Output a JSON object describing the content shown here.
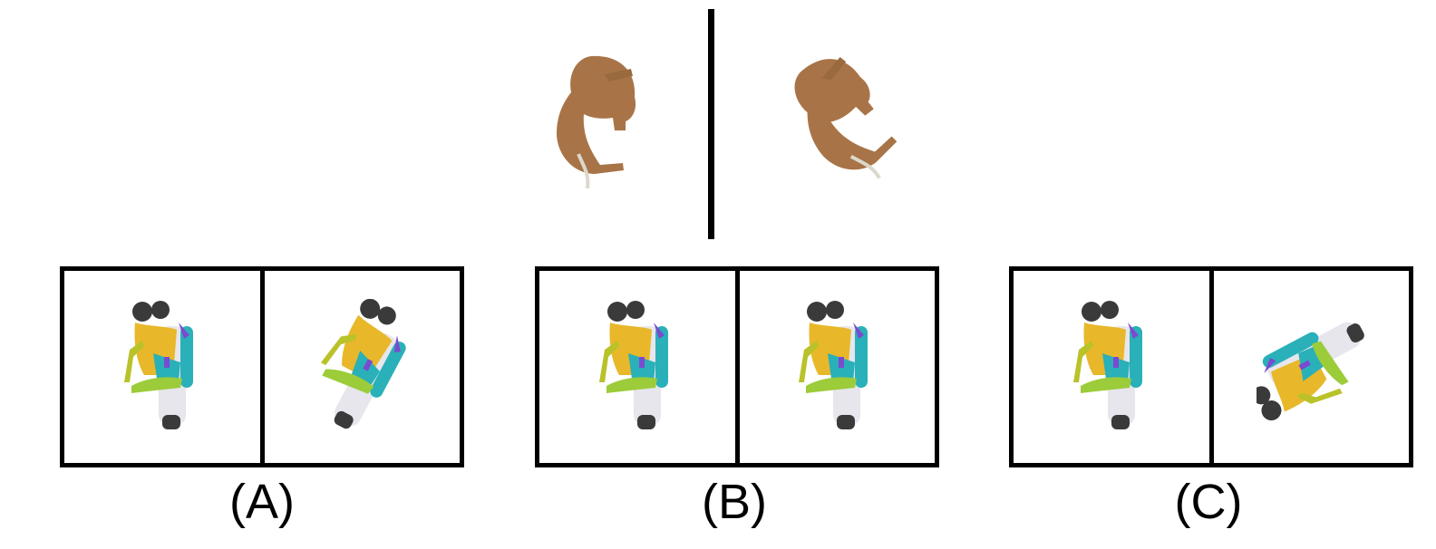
{
  "reference": {
    "left_icon": "elephant-icon",
    "right_icon": "elephant-rotated-icon"
  },
  "options": [
    {
      "label": "(A)",
      "left_icon": "motorcycle-rider-icon",
      "right_icon": "motorcycle-rider-rotated-icon"
    },
    {
      "label": "(B)",
      "left_icon": "motorcycle-rider-icon",
      "right_icon": "motorcycle-rider-icon"
    },
    {
      "label": "(C)",
      "left_icon": "motorcycle-rider-icon",
      "right_icon": "motorcycle-rider-rotated-icon"
    }
  ],
  "colors": {
    "elephant": "#a87447",
    "tusk": "#dcd8cc",
    "rider_skin": "#e8b82a",
    "hair": "#3a3a3a",
    "teal": "#2ab0b8",
    "green": "#9ccc3a",
    "purple": "#7a4bd0",
    "bike": "#e6e6ec"
  }
}
